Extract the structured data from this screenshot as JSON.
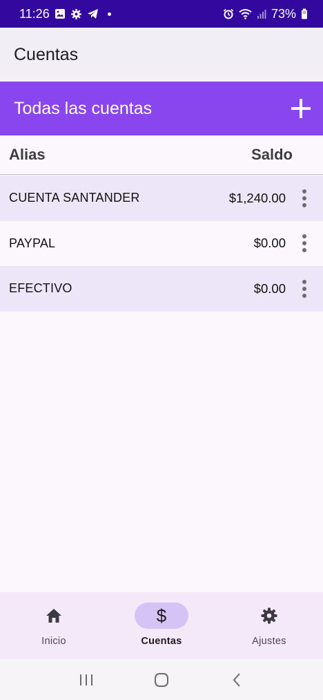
{
  "status_bar": {
    "time": "11:26",
    "battery": "73%",
    "left_icons": [
      "gallery-icon",
      "gear-notification-icon",
      "telegram-icon"
    ],
    "right_icons": [
      "alarm-icon",
      "wifi-icon",
      "signal-icon",
      "battery-icon"
    ]
  },
  "app_bar": {
    "title": "Cuentas"
  },
  "banner": {
    "title": "Todas las cuentas",
    "add_icon": "plus-icon"
  },
  "table": {
    "headers": {
      "alias": "Alias",
      "saldo": "Saldo"
    },
    "rows": [
      {
        "alias": "CUENTA SANTANDER",
        "saldo": "$1,240.00"
      },
      {
        "alias": "PAYPAL",
        "saldo": "$0.00"
      },
      {
        "alias": "EFECTIVO",
        "saldo": "$0.00"
      }
    ]
  },
  "bottom_nav": {
    "items": [
      {
        "label": "Inicio",
        "icon": "home-icon",
        "active": false
      },
      {
        "label": "Cuentas",
        "icon": "dollar-icon",
        "active": true
      },
      {
        "label": "Ajustes",
        "icon": "settings-icon",
        "active": false
      }
    ]
  },
  "colors": {
    "status_bar": "#33089e",
    "app_bar": "#f2eef6",
    "banner": "#8a46ee",
    "row_shaded": "#ede6f8",
    "nav_bg": "#f3e9f9",
    "nav_active_pill": "#d6c3f5"
  }
}
